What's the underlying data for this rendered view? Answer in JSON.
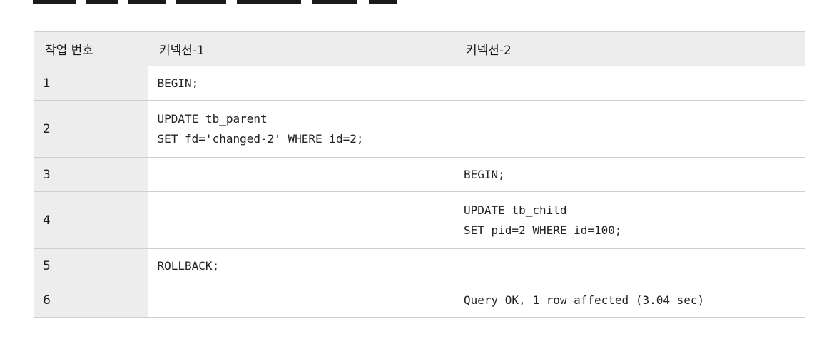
{
  "table": {
    "headers": [
      "작업 번호",
      "커넥션-1",
      "커넥션-2"
    ],
    "rows": [
      {
        "step": "1",
        "conn1": [
          "BEGIN;"
        ],
        "conn2": []
      },
      {
        "step": "2",
        "conn1": [
          "UPDATE tb_parent",
          "SET fd='changed-2' WHERE id=2;"
        ],
        "conn2": []
      },
      {
        "step": "3",
        "conn1": [],
        "conn2": [
          "BEGIN;"
        ]
      },
      {
        "step": "4",
        "conn1": [],
        "conn2": [
          "UPDATE tb_child",
          "SET pid=2 WHERE id=100;"
        ]
      },
      {
        "step": "5",
        "conn1": [
          "ROLLBACK;"
        ],
        "conn2": []
      },
      {
        "step": "6",
        "conn1": [],
        "conn2": [
          "Query OK, 1 row affected (3.04 sec)"
        ]
      }
    ]
  }
}
